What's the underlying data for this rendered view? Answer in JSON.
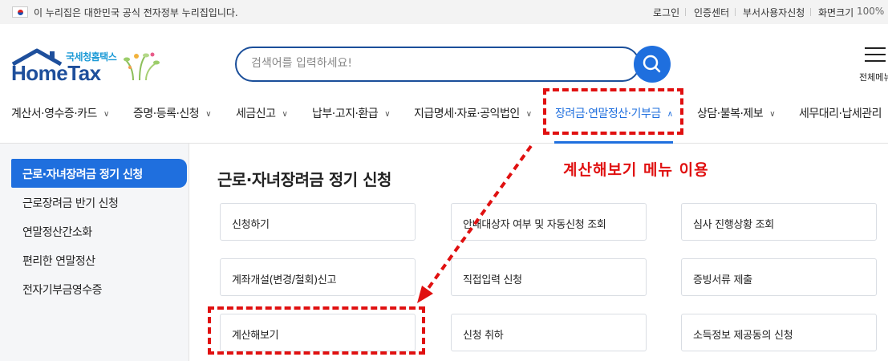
{
  "topbar": {
    "gov_notice": "이 누리집은 대한민국 공식 전자정부 누리집입니다.",
    "login": "로그인",
    "cert_center": "인증센터",
    "dept_user": "부서사용자신청",
    "zoom_label": "화면크기",
    "zoom_value": "100%"
  },
  "header": {
    "logo_sub": "국세청홈택스",
    "logo_main": "HomeTax",
    "search_placeholder": "검색어를 입력하세요!",
    "all_menu": "전체메뉴"
  },
  "nav": {
    "items": [
      "계산서·영수증·카드",
      "증명·등록·신청",
      "세금신고",
      "납부·고지·환급",
      "지급명세·자료·공익법인",
      "장려금·연말정산·기부금",
      "상담·불복·제보",
      "세무대리·납세관리"
    ]
  },
  "sidebar": {
    "items": [
      "근로·자녀장려금 정기 신청",
      "근로장려금 반기 신청",
      "연말정산간소화",
      "편리한 연말정산",
      "전자기부금영수증"
    ]
  },
  "content": {
    "title": "근로·자녀장려금 정기 신청",
    "cards": [
      "신청하기",
      "안내대상자 여부 및 자동신청 조회",
      "심사 진행상황 조회",
      "계좌개설(변경/철회)신고",
      "직접입력 신청",
      "증빙서류 제출",
      "계산해보기",
      "신청 취하",
      "소득정보 제공동의 신청"
    ]
  },
  "annotation": {
    "text": "계산해보기 메뉴 이용",
    "color": "#e01010"
  },
  "colors": {
    "accent": "#1f6fde",
    "brand": "#1e4f9c"
  }
}
